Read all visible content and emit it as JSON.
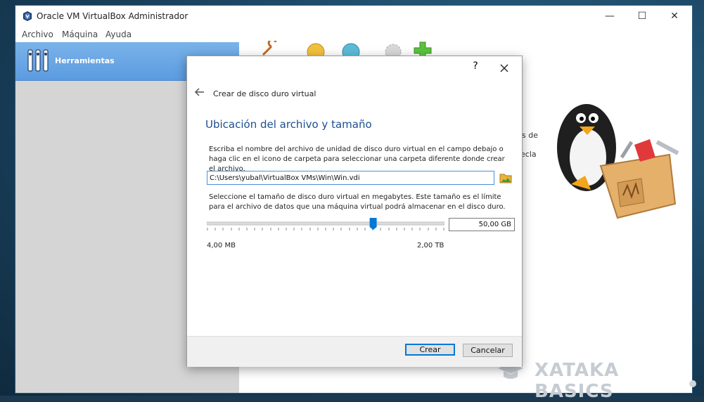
{
  "window": {
    "title": "Oracle VM VirtualBox Administrador",
    "minimize_glyph": "—",
    "maximize_glyph": "☐",
    "close_glyph": "✕"
  },
  "menu": [
    "Archivo",
    "Máquina",
    "Ayuda"
  ],
  "sidebar": {
    "tools_label": "Herramientas"
  },
  "right_panel": {
    "clipped_text_1": "s de",
    "clipped_text_2": "ecla"
  },
  "dialog": {
    "help_glyph": "?",
    "heading": "Crear de disco duro virtual",
    "section_title": "Ubicación del archivo y tamaño",
    "location_description": "Escriba el nombre del archivo de unidad de disco duro virtual en el campo debajo o haga clic en el icono de carpeta para seleccionar una carpeta diferente donde crear el archivo.",
    "file_path": "C:\\Users\\yubal\\VirtualBox VMs\\Win\\Win.vdi",
    "size_description": "Seleccione el tamaño de disco duro virtual en megabytes. Este tamaño es el límite para el archivo de datos que una máquina virtual podrá almacenar en el disco duro.",
    "size_value": "50,00 GB",
    "slider_position": 0.7,
    "min_label": "4,00 MB",
    "max_label": "2,00 TB",
    "create_button": "Crear",
    "cancel_button": "Cancelar"
  },
  "watermark": "XATAKA BASICS",
  "colors": {
    "accent": "#0078d7",
    "section_title": "#1d4f8f",
    "tools_bg": "#5b9be0"
  }
}
